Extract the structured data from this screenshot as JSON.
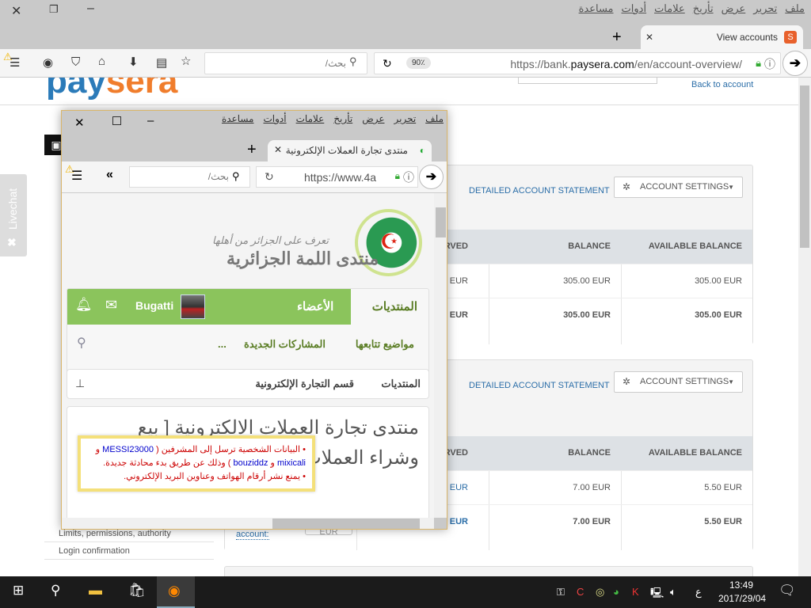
{
  "browser": {
    "menu": [
      "ملف",
      "تحرير",
      "عرض",
      "تأريخ",
      "علامات",
      "أدوات",
      "مساعدة"
    ],
    "tab_title": "View accounts",
    "tab_favicon": "S",
    "search_placeholder": "بحث/",
    "zoom": "90٪",
    "url_prefix": "https://bank.",
    "url_domain": "paysera.com",
    "url_path": "/en/account-overview/"
  },
  "page": {
    "logo_a": "pay",
    "logo_b": "sera",
    "back_link": "Back to account",
    "livechat": "Livechat",
    "sidebar": [
      "Limits, permissions, authority",
      "Login confirmation"
    ],
    "panels": [
      {
        "statement_link": "DETAILED ACCOUNT STATEMENT",
        "settings_label": "ACCOUNT SETTINGS",
        "headers": [
          "SERVED",
          "BALANCE",
          "AVAILABLE BALANCE"
        ],
        "rows": [
          [
            "0.00 EUR",
            "305.00 EUR",
            "305.00 EUR"
          ],
          [
            "0.00 EUR",
            "305.00 EUR",
            "305.00 EUR"
          ]
        ]
      },
      {
        "statement_link": "DETAILED ACCOUNT STATEMENT",
        "settings_label": "ACCOUNT SETTINGS",
        "headers": [
          "SERVED",
          "BALANCE",
          "AVAILABLE BALANCE"
        ],
        "rows": [
          [
            "1.50 EUR",
            "7.00 EUR",
            "5.50 EUR"
          ],
          [
            "1.50 EUR",
            "7.00 EUR",
            "5.50 EUR"
          ]
        ],
        "account_link": "account:",
        "currency": "EUR"
      }
    ]
  },
  "popup": {
    "menu": [
      "ملف",
      "تحرير",
      "عرض",
      "تأريخ",
      "علامات",
      "أدوات",
      "مساعدة"
    ],
    "tab_title": "منتدى تجارة العملات الإلكترونية",
    "search_placeholder": "بحث/",
    "url": "https://www.4a",
    "logo_tagline": "تعرف على الجزائر من أهلها",
    "logo_title": "منتدى اللمة الجزائرية",
    "nav_forums": "المنتديات",
    "nav_members": "الأعضاء",
    "username": "Bugatti",
    "sub_followed": "مواضيع تتابعها",
    "sub_new_posts": "المشاركات الجديدة",
    "sub_more": "...",
    "crumb_1": "المنتديات",
    "crumb_2": "قسم التجارة الإلكترونية",
    "post_title_1": "منتدى تجارة العملات الالكترونية [ بيع",
    "post_title_2": "وشراء العملات",
    "notice_1a": "• البيانات الشخصية ترسل إلى المشرفين ( ",
    "notice_1b": "MESSI23000",
    "notice_1c": " و",
    "notice_2a": "mixicali",
    "notice_2b": " و ",
    "notice_2c": "bouziddz",
    "notice_2d": " ) وذلك عن طريق بدء محادثة جديدة.",
    "notice_3": "• يمنع نشر أرقام الهواتف وعناوين البريد الإلكتروني."
  },
  "taskbar": {
    "time": "13:49",
    "date": "2017/29/04",
    "lang": "ع"
  },
  "colors": {
    "accent": "#2b6ea8",
    "forum_green": "#8bc45c",
    "notice_border": "#f4e07a"
  }
}
